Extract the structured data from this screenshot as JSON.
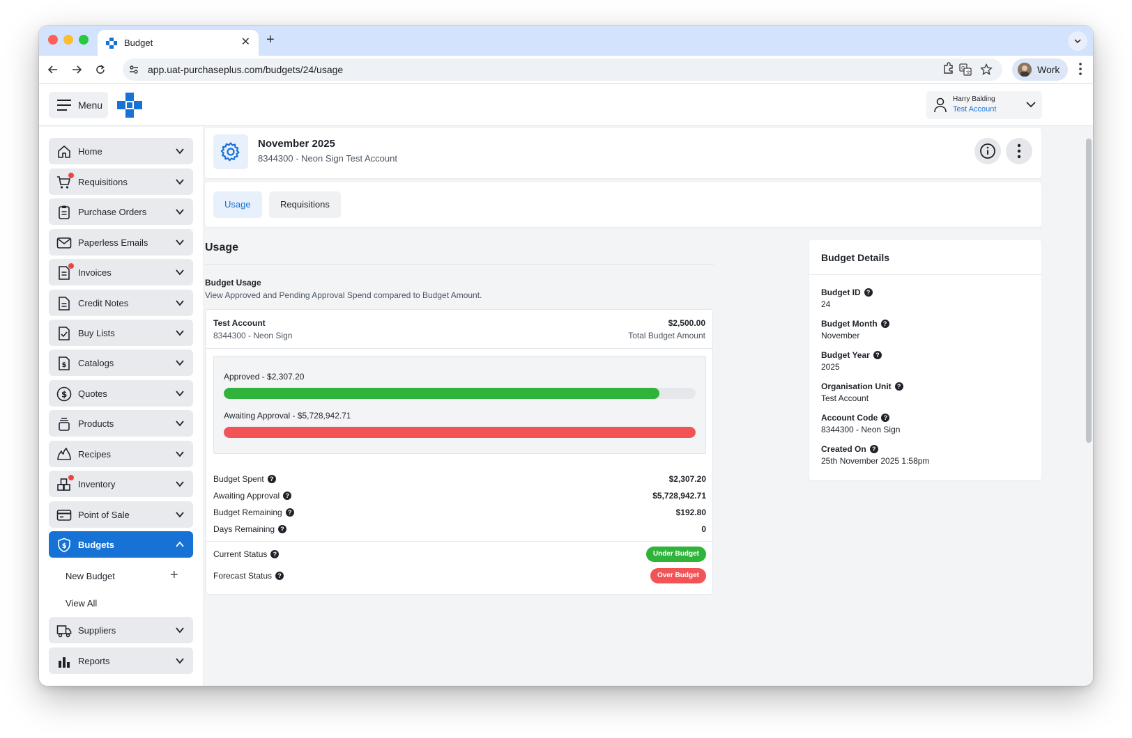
{
  "browser": {
    "tab_title": "Budget",
    "url": "app.uat-purchaseplus.com/budgets/24/usage",
    "profile_label": "Work"
  },
  "header": {
    "menu_label": "Menu",
    "user_name": "Harry Balding",
    "user_account": "Test Account"
  },
  "sidebar": {
    "items": [
      {
        "label": "Home",
        "icon": "home-icon"
      },
      {
        "label": "Requisitions",
        "icon": "cart-icon",
        "notify": true
      },
      {
        "label": "Purchase Orders",
        "icon": "clipboard-icon"
      },
      {
        "label": "Paperless Emails",
        "icon": "envelope-icon"
      },
      {
        "label": "Invoices",
        "icon": "invoice-icon",
        "notify": true
      },
      {
        "label": "Credit Notes",
        "icon": "document-icon"
      },
      {
        "label": "Buy Lists",
        "icon": "checklist-icon"
      },
      {
        "label": "Catalogs",
        "icon": "catalog-icon"
      },
      {
        "label": "Quotes",
        "icon": "dollar-circle-icon"
      },
      {
        "label": "Products",
        "icon": "products-icon"
      },
      {
        "label": "Recipes",
        "icon": "flame-icon"
      },
      {
        "label": "Inventory",
        "icon": "boxes-icon",
        "notify": true
      },
      {
        "label": "Point of Sale",
        "icon": "card-icon"
      },
      {
        "label": "Budgets",
        "icon": "shield-dollar-icon",
        "active": true
      },
      {
        "label": "Suppliers",
        "icon": "truck-icon"
      },
      {
        "label": "Reports",
        "icon": "bar-chart-icon"
      }
    ],
    "budgets_sub": {
      "new_label": "New Budget",
      "view_all_label": "View All"
    }
  },
  "page": {
    "title": "November 2025",
    "subtitle": "8344300 - Neon Sign Test Account"
  },
  "tabs": [
    {
      "label": "Usage",
      "active": true
    },
    {
      "label": "Requisitions",
      "active": false
    }
  ],
  "usage": {
    "section_title": "Usage",
    "budget_usage_title": "Budget Usage",
    "budget_usage_desc": "View Approved and Pending Approval Spend compared to Budget Amount.",
    "account_name": "Test Account",
    "account_sub": "8344300 - Neon Sign",
    "total_amount": "$2,500.00",
    "total_label": "Total Budget Amount",
    "approved_label": "Approved - $2,307.20",
    "approved_fraction": 0.923,
    "approved_color": "#30b33a",
    "awaiting_label": "Awaiting Approval - $5,728,942.71",
    "awaiting_fraction": 1.0,
    "awaiting_color": "#f25357",
    "stats": [
      {
        "label": "Budget Spent",
        "value": "$2,307.20"
      },
      {
        "label": "Awaiting Approval",
        "value": "$5,728,942.71"
      },
      {
        "label": "Budget Remaining",
        "value": "$192.80"
      },
      {
        "label": "Days Remaining",
        "value": "0"
      }
    ],
    "current_status_label": "Current Status",
    "current_status_value": "Under Budget",
    "current_status_color": "#30b33a",
    "forecast_status_label": "Forecast Status",
    "forecast_status_value": "Over Budget",
    "forecast_status_color": "#f25357"
  },
  "details": {
    "title": "Budget Details",
    "fields": [
      {
        "label": "Budget ID",
        "value": "24"
      },
      {
        "label": "Budget Month",
        "value": "November"
      },
      {
        "label": "Budget Year",
        "value": "2025"
      },
      {
        "label": "Organisation Unit",
        "value": "Test Account"
      },
      {
        "label": "Account Code",
        "value": "8344300 - Neon Sign"
      },
      {
        "label": "Created On",
        "value": "25th November 2025 1:58pm"
      }
    ]
  },
  "colors": {
    "primary": "#1772d6"
  }
}
